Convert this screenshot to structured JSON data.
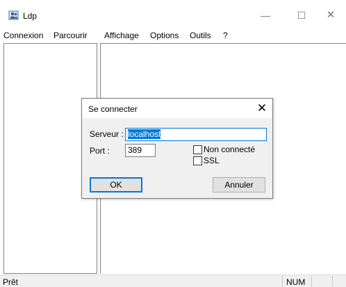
{
  "window": {
    "title": "Ldp",
    "minimize_glyph": "—",
    "maximize_glyph": "☐",
    "close_glyph": "✕"
  },
  "menu": {
    "items": [
      "Connexion",
      "Parcourir",
      "Affichage",
      "Options",
      "Outils",
      "?"
    ]
  },
  "status": {
    "text": "Prêt",
    "num": "NUM"
  },
  "dialog": {
    "title": "Se connecter",
    "close_glyph": "✕",
    "server_label": "Serveur :",
    "server_value": "localhost",
    "port_label": "Port :",
    "port_value": "389",
    "non_connecte_label": "Non connecté",
    "ssl_label": "SSL",
    "ok_label": "OK",
    "cancel_label": "Annuler"
  },
  "colors": {
    "accent": "#0078d7",
    "dialog_bg": "#f0f0f0",
    "button_bg": "#e1e1e1"
  },
  "icons": {
    "app": "ldp-app-icon"
  }
}
